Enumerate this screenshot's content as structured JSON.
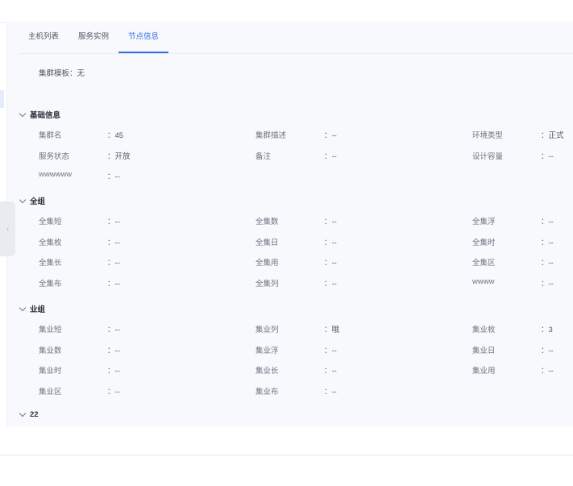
{
  "tabs": [
    {
      "label": "主机列表",
      "active": false
    },
    {
      "label": "服务实例",
      "active": false
    },
    {
      "label": "节点信息",
      "active": true
    }
  ],
  "cluster_template": {
    "label": "集群模板：",
    "value": "无"
  },
  "colors": {
    "accent": "#2f6fe4",
    "panel_bg": "#f8f9fc",
    "label": "#6d7380",
    "value": "#4f5563"
  },
  "icons": {
    "section_toggle": "chevron-down-icon",
    "collapse_handle": "chevron-left-icon"
  },
  "collapse_handle_glyph": "‹",
  "sections": [
    {
      "title": "基础信息",
      "fields": [
        {
          "label": "集群名",
          "value": "45"
        },
        {
          "label": "集群描述",
          "value": "--"
        },
        {
          "label": "环境类型",
          "value": "正式"
        },
        {
          "label": "服务状态",
          "value": "开放"
        },
        {
          "label": "备注",
          "value": "--"
        },
        {
          "label": "设计容量",
          "value": "--"
        },
        {
          "label": "wwwwww",
          "value": "--"
        }
      ]
    },
    {
      "title": "全组",
      "fields": [
        {
          "label": "全集短",
          "value": "--"
        },
        {
          "label": "全集数",
          "value": "--"
        },
        {
          "label": "全集浮",
          "value": "--"
        },
        {
          "label": "全集枚",
          "value": "--"
        },
        {
          "label": "全集日",
          "value": "--"
        },
        {
          "label": "全集时",
          "value": "--"
        },
        {
          "label": "全集长",
          "value": "--"
        },
        {
          "label": "全集用",
          "value": "--"
        },
        {
          "label": "全集区",
          "value": "--"
        },
        {
          "label": "全集布",
          "value": "--"
        },
        {
          "label": "全集列",
          "value": "--"
        },
        {
          "label": "wwww",
          "value": "--"
        }
      ]
    },
    {
      "title": "业组",
      "fields": [
        {
          "label": "集业短",
          "value": "--"
        },
        {
          "label": "集业列",
          "value": "哦"
        },
        {
          "label": "集业枚",
          "value": "3"
        },
        {
          "label": "集业数",
          "value": "--"
        },
        {
          "label": "集业浮",
          "value": "--"
        },
        {
          "label": "集业日",
          "value": "--"
        },
        {
          "label": "集业时",
          "value": "--"
        },
        {
          "label": "集业长",
          "value": "--"
        },
        {
          "label": "集业用",
          "value": "--"
        },
        {
          "label": "集业区",
          "value": "--"
        },
        {
          "label": "集业布",
          "value": "--"
        }
      ]
    },
    {
      "title": "22",
      "fields": []
    }
  ]
}
